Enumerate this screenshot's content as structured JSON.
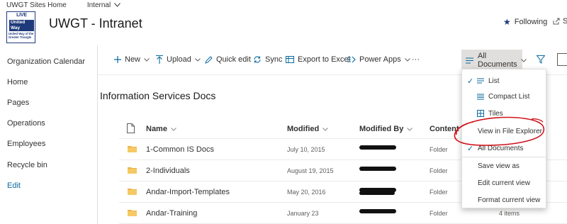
{
  "suite_bar": {
    "home_label": "UWGT Sites Home",
    "internal_label": "Internal"
  },
  "site": {
    "logo_text_top": "LIVE UNITED",
    "logo_hand_line1": "United",
    "logo_hand_line2": "Way",
    "logo_sub": "United Way of the Greater Triangle",
    "title": "UWGT - Intranet",
    "following_label": "Following",
    "share_label": "S"
  },
  "left_nav": {
    "items": [
      {
        "label": "Organization Calendar"
      },
      {
        "label": "Home"
      },
      {
        "label": "Pages"
      },
      {
        "label": "Operations"
      },
      {
        "label": "Employees"
      },
      {
        "label": "Recycle bin"
      }
    ],
    "edit_label": "Edit"
  },
  "command_bar": {
    "new_label": "New",
    "upload_label": "Upload",
    "quick_edit_label": "Quick edit",
    "sync_label": "Sync",
    "export_label": "Export to Excel",
    "power_apps_label": "Power Apps",
    "more_label": "···",
    "view_label": "All Documents"
  },
  "list": {
    "title": "Information Services Docs",
    "columns": {
      "name": "Name",
      "modified": "Modified",
      "modified_by": "Modified By",
      "content_type": "Content Ty"
    },
    "rows": [
      {
        "name": "1-Common IS Docs",
        "modified": "July 10, 2015",
        "content_type": "Folder",
        "extra": ""
      },
      {
        "name": "2-Individuals",
        "modified": "August 19, 2015",
        "content_type": "Folder",
        "extra": ""
      },
      {
        "name": "Andar-Import-Templates",
        "modified": "May 20, 2016",
        "content_type": "Folder",
        "extra": ""
      },
      {
        "name": "Andar-Training",
        "modified": "January 23",
        "content_type": "Folder",
        "extra": "4 items"
      }
    ]
  },
  "view_menu": {
    "list_label": "List",
    "compact_list_label": "Compact List",
    "tiles_label": "Tiles",
    "file_explorer_label": "View in File Explorer",
    "all_documents_label": "All Documents",
    "save_view_label": "Save view as",
    "edit_view_label": "Edit current view",
    "format_view_label": "Format current view"
  },
  "colors": {
    "accent": "#0b6a9e",
    "annotation": "#d0121b",
    "brand_navy": "#1f3a7a"
  }
}
